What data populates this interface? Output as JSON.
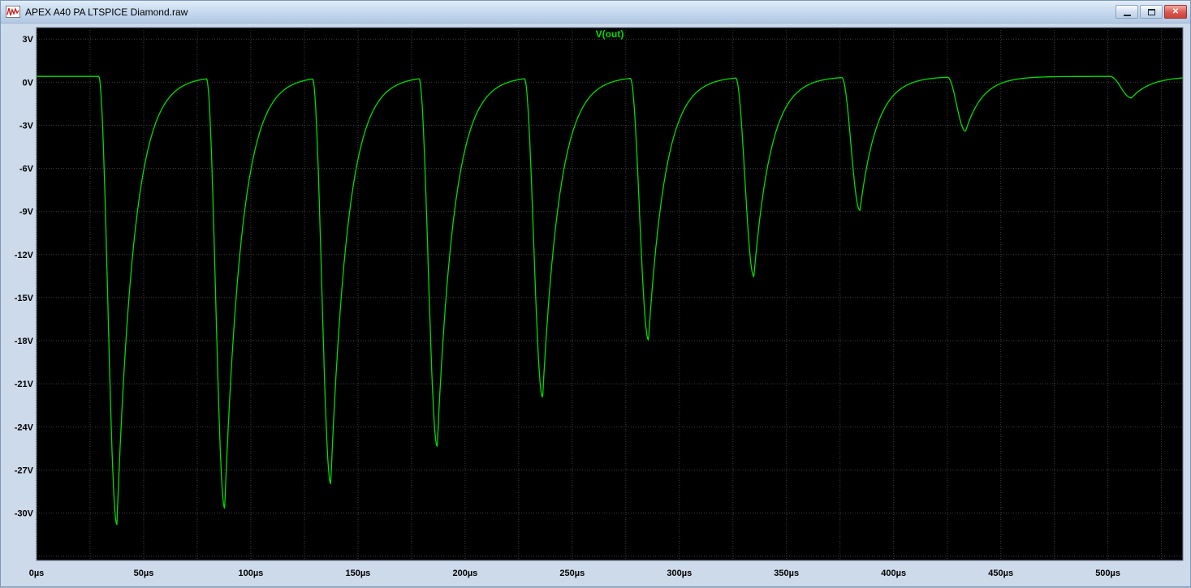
{
  "window": {
    "title": "APEX A40 PA LTSPICE Diamond.raw",
    "icons": {
      "app": "waveform-icon",
      "minimize": "minimize-bar",
      "maximize": "maximize-square",
      "close": "✕"
    }
  },
  "plot": {
    "title": "V(out)"
  },
  "colors": {
    "trace_green": "#00dc00",
    "plot_bg": "#000000",
    "grid": "#404040",
    "frame_bg": "#cddaea",
    "tick_text": "#000000",
    "close_red": "#d9534f"
  },
  "chart_data": {
    "type": "line",
    "title": "V(out)",
    "x_unit": "µs",
    "y_unit": "V",
    "x_range": [
      0,
      535
    ],
    "y_range": [
      -33.3,
      3.8
    ],
    "x_grid": {
      "start": 0,
      "step": 25,
      "end": 525
    },
    "y_grid": {
      "top": 3,
      "step": 3,
      "bottom": -33
    },
    "x_ticks": {
      "values": [
        0,
        50,
        100,
        150,
        200,
        250,
        300,
        350,
        400,
        450,
        500
      ],
      "labels": [
        "0µs",
        "50µs",
        "100µs",
        "150µs",
        "200µs",
        "250µs",
        "300µs",
        "350µs",
        "400µs",
        "450µs",
        "500µs"
      ]
    },
    "y_ticks": {
      "values": [
        3,
        0,
        -3,
        -6,
        -9,
        -12,
        -15,
        -18,
        -21,
        -24,
        -27,
        -30
      ],
      "labels": [
        "3V",
        "0V",
        "-3V",
        "-6V",
        "-9V",
        "-12V",
        "-15V",
        "-18V",
        "-21V",
        "-24V",
        "-27V",
        "-30V"
      ]
    },
    "baseline_v": 0.4,
    "fall_time_us": 8.5,
    "recovery_tau_us": 8,
    "dips": [
      {
        "t_trough": 37.5,
        "v_min": -30.8
      },
      {
        "t_trough": 87.8,
        "v_min": -29.6
      },
      {
        "t_trough": 137.3,
        "v_min": -27.9
      },
      {
        "t_trough": 187.0,
        "v_min": -25.3
      },
      {
        "t_trough": 236.2,
        "v_min": -21.9
      },
      {
        "t_trough": 285.6,
        "v_min": -17.9
      },
      {
        "t_trough": 334.8,
        "v_min": -13.5
      },
      {
        "t_trough": 384.3,
        "v_min": -8.9
      },
      {
        "t_trough": 433.6,
        "v_min": -3.4
      },
      {
        "t_trough": 511.0,
        "v_min": -1.1,
        "fall_us": 10,
        "tau_us": 9
      }
    ]
  }
}
